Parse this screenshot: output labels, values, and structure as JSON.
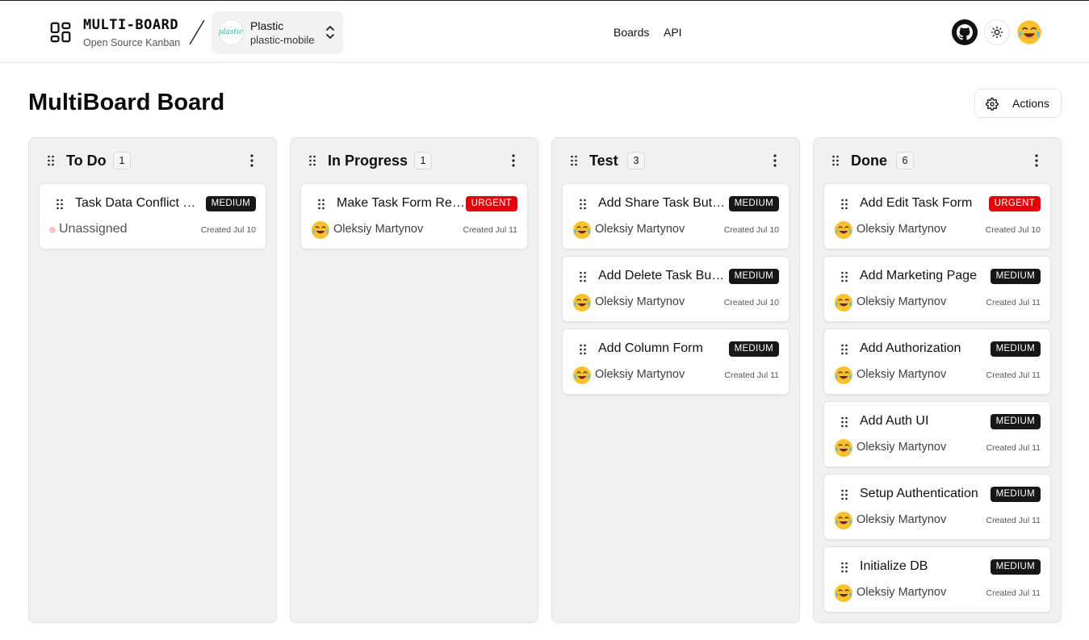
{
  "header": {
    "brand_name": "MULTI-BOARD",
    "brand_subtitle": "Open Source Kanban",
    "org": {
      "avatar_text": "plastic",
      "name": "Plastic",
      "slug": "plastic-mobile"
    },
    "nav": {
      "boards": "Boards",
      "api": "API"
    }
  },
  "page": {
    "title": "MultiBoard Board",
    "actions_label": "Actions"
  },
  "columns": [
    {
      "title": "To Do",
      "count": "1",
      "cards": [
        {
          "title": "Task Data Conflict Resolution",
          "priority": "MEDIUM",
          "assignee": "Unassigned",
          "created": "Created Jul 10"
        }
      ]
    },
    {
      "title": "In Progress",
      "count": "1",
      "cards": [
        {
          "title": "Make Task Form Responsive",
          "priority": "URGENT",
          "assignee": "Oleksiy Martynov",
          "created": "Created Jul 11"
        }
      ]
    },
    {
      "title": "Test",
      "count": "3",
      "cards": [
        {
          "title": "Add Share Task Button",
          "priority": "MEDIUM",
          "assignee": "Oleksiy Martynov",
          "created": "Created Jul 10"
        },
        {
          "title": "Add Delete Task Button",
          "priority": "MEDIUM",
          "assignee": "Oleksiy Martynov",
          "created": "Created Jul 10"
        },
        {
          "title": "Add Column Form",
          "priority": "MEDIUM",
          "assignee": "Oleksiy Martynov",
          "created": "Created Jul 11"
        }
      ]
    },
    {
      "title": "Done",
      "count": "6",
      "cards": [
        {
          "title": "Add Edit Task Form",
          "priority": "URGENT",
          "assignee": "Oleksiy Martynov",
          "created": "Created Jul 10"
        },
        {
          "title": "Add Marketing Page",
          "priority": "MEDIUM",
          "assignee": "Oleksiy Martynov",
          "created": "Created Jul 11"
        },
        {
          "title": "Add Authorization",
          "priority": "MEDIUM",
          "assignee": "Oleksiy Martynov",
          "created": "Created Jul 11"
        },
        {
          "title": "Add Auth UI",
          "priority": "MEDIUM",
          "assignee": "Oleksiy Martynov",
          "created": "Created Jul 11"
        },
        {
          "title": "Setup Authentication",
          "priority": "MEDIUM",
          "assignee": "Oleksiy Martynov",
          "created": "Created Jul 11"
        },
        {
          "title": "Initialize DB",
          "priority": "MEDIUM",
          "assignee": "Oleksiy Martynov",
          "created": "Created Jul 11"
        }
      ]
    }
  ],
  "colors": {
    "medium_badge": "#171717",
    "urgent_badge": "#e7000b",
    "column_bg": "#f1f1f1"
  },
  "icons": {
    "logo": "layout-dashboard-icon",
    "github": "github-icon",
    "theme": "sun-icon",
    "settings": "gear-icon",
    "drag": "grip-vertical-icon",
    "menu": "more-vertical-icon"
  }
}
